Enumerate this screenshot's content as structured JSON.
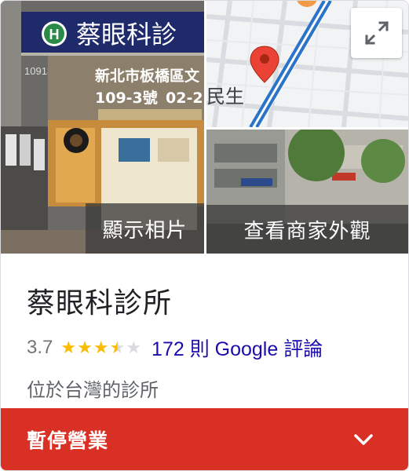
{
  "place": {
    "name": "蔡眼科診所",
    "rating": "3.7",
    "rating_value": 3.7,
    "stars_max": 5,
    "reviews_label": "172 則 Google 評論",
    "category": "位於台灣的診所",
    "status": "暫停營業"
  },
  "photos": {
    "show_photos_label": "顯示相片",
    "street_view_label": "查看商家外觀",
    "sign_name": "蔡眼科診",
    "sign_address_1": "新北市板橋區文",
    "sign_address_2": "109-3號",
    "sign_phone": "02-2",
    "map_street_label": "民生"
  },
  "colors": {
    "status_bg": "#d93025",
    "star": "#fbbc04",
    "link": "#1a0dab",
    "map_pin": "#ea4335"
  },
  "icons": {
    "expand": "expand-arrows-icon",
    "chevron": "chevron-down-icon",
    "map_pin": "map-pin-icon",
    "star": "star-icon"
  }
}
